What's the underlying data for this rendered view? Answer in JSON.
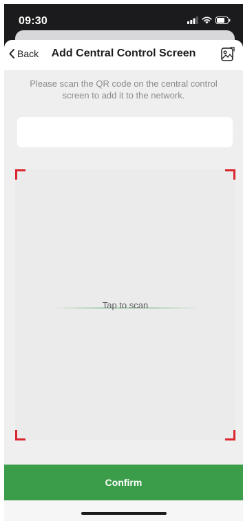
{
  "status_bar": {
    "time": "09:30",
    "icons": [
      "cellular-signal-icon",
      "wifi-icon",
      "battery-icon"
    ]
  },
  "navbar": {
    "back_label": "Back",
    "title": "Add Central Control Screen",
    "back_icon": "chevron-left-icon",
    "right_icon": "photo-album-icon"
  },
  "instruction": "Please scan the QR code on the central control screen to add it to the network.",
  "code_input": {
    "value": "",
    "placeholder": ""
  },
  "scanner": {
    "hint": "Tap to scan"
  },
  "confirm_label": "Confirm",
  "colors": {
    "accent_green": "#3b9c4a",
    "scan_line": "#37a04b",
    "corner_red": "#d9252d",
    "background": "#efefef"
  }
}
